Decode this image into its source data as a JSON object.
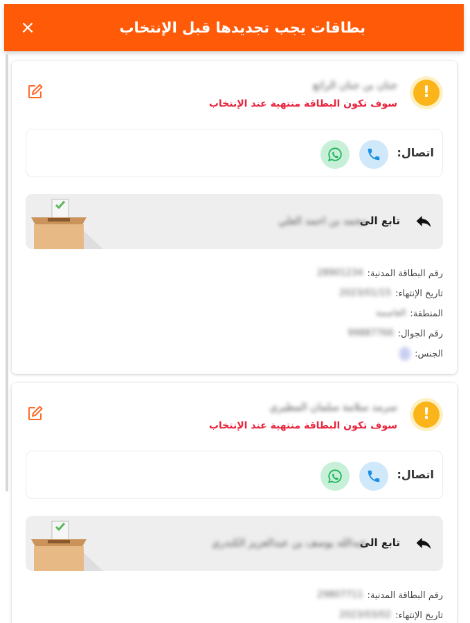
{
  "header": {
    "title": "بطاقات يجب تجديدها قبل الإنتخاب",
    "close_label": "×"
  },
  "labels": {
    "warning_text": "سوف تكون البطاقة منتهية عند الإنتخاب",
    "contact": "اتصال:",
    "follow": "تابع الى",
    "civil_id": "رقم البطاقة المدنية:",
    "expiry": "تاريخ الإنتهاء:",
    "region": "المنطقة:",
    "mobile": "رقم الجوال:",
    "gender": "الجنس:",
    "warning_glyph": "!"
  },
  "cards": [
    {
      "name": "جنان بن جنان الراتع",
      "follow_name": "محمد بن احمد العلي",
      "civil_id": "28901234",
      "expiry": "2023/01/15",
      "region": "العاصمة",
      "mobile": "99887766",
      "gender": "ذ"
    },
    {
      "name": "سرمد سلامة سلمان المطيري",
      "follow_name": "عبدالله يوسف بن عبدالعزيز الكندري",
      "civil_id": "29807711",
      "expiry": "2023/03/02"
    }
  ],
  "icons": {
    "warning": "exclamation-icon",
    "edit": "edit-icon",
    "phone": "phone-icon",
    "whatsapp": "whatsapp-icon",
    "reply": "reply-icon",
    "ballot": "ballot-box-icon",
    "close": "close-icon"
  },
  "colors": {
    "header_bg": "#ff5a08",
    "warning_text": "#e8253e",
    "warning_icon": "#fbb41a",
    "phone_bg": "#cfe8fa",
    "whatsapp_bg": "#c8f0d9",
    "follow_bg": "#eeeeef"
  }
}
